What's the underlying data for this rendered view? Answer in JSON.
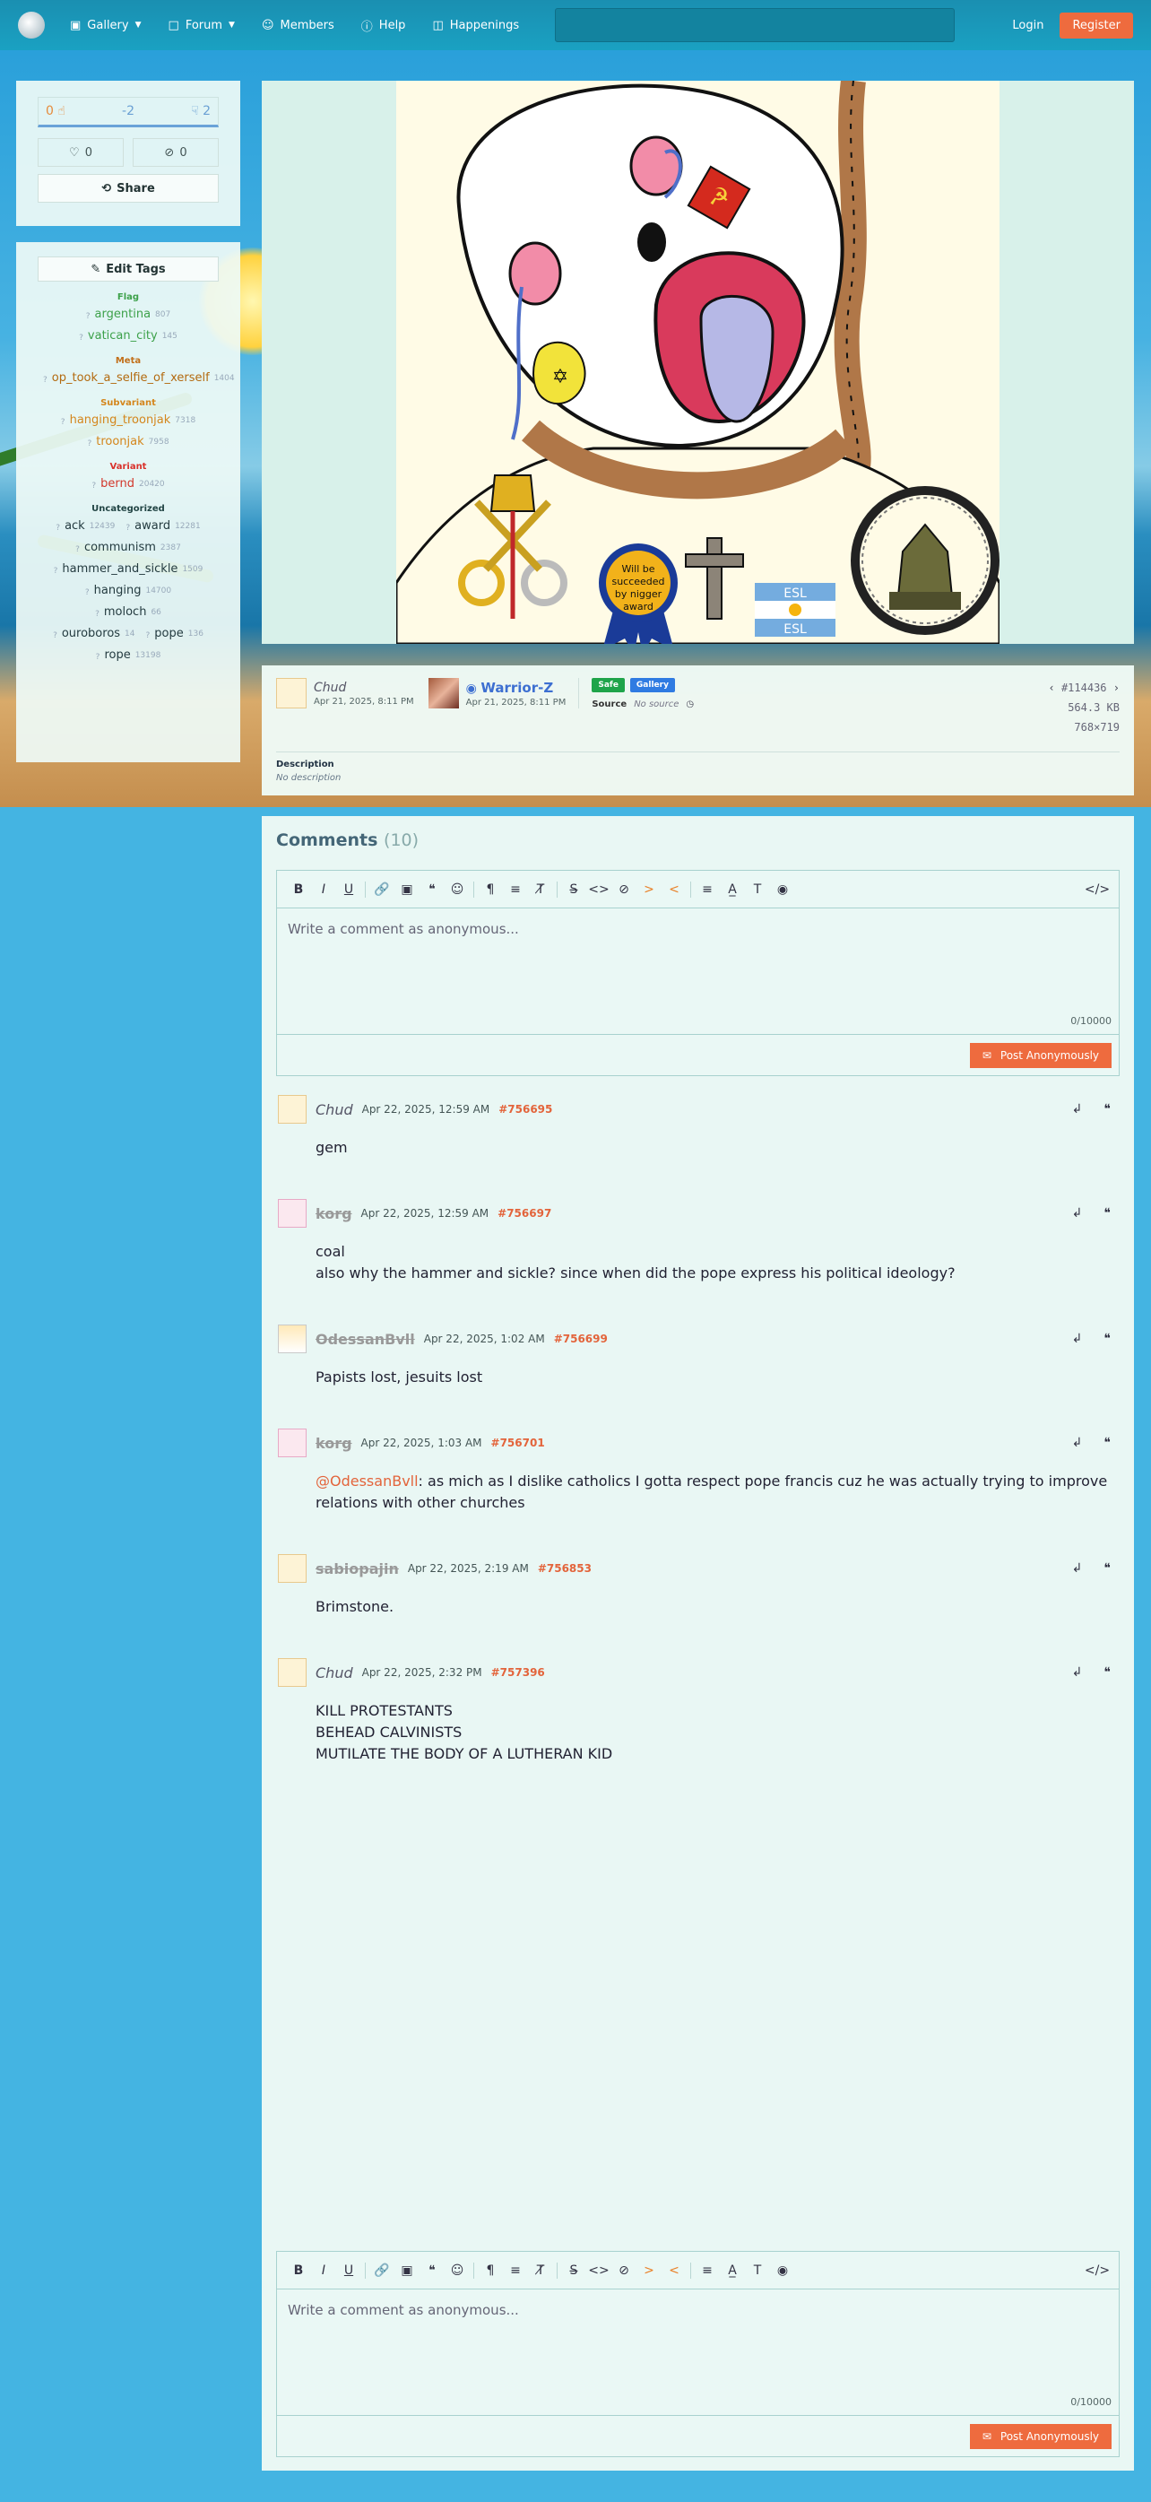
{
  "nav": {
    "items": [
      {
        "label": "Gallery",
        "icon": "image-icon",
        "dropdown": true
      },
      {
        "label": "Forum",
        "icon": "chat-icon",
        "dropdown": true
      },
      {
        "label": "Members",
        "icon": "user-icon",
        "dropdown": false
      },
      {
        "label": "Help",
        "icon": "help-icon",
        "dropdown": false
      },
      {
        "label": "Happenings",
        "icon": "book-icon",
        "dropdown": false
      }
    ],
    "search_placeholder": "",
    "login": "Login",
    "register": "Register"
  },
  "votes": {
    "up": "0",
    "score": "-2",
    "down": "2",
    "favorites": "0",
    "hidden": "0",
    "share": "Share"
  },
  "tags": {
    "edit_label": "Edit Tags",
    "groups": [
      {
        "title": "Flag",
        "tags": [
          [
            "argentina",
            "807"
          ],
          [
            "vatican_city",
            "145"
          ]
        ]
      },
      {
        "title": "Meta",
        "tags": [
          [
            "op_took_a_selfie_of_xerself",
            "1404"
          ]
        ]
      },
      {
        "title": "Subvariant",
        "tags": [
          [
            "hanging_troonjak",
            "7318"
          ],
          [
            "troonjak",
            "7958"
          ]
        ]
      },
      {
        "title": "Variant",
        "tags": [
          [
            "bernd",
            "20420"
          ]
        ]
      },
      {
        "title": "Uncategorized",
        "tags": [
          [
            "ack",
            "12439"
          ],
          [
            "award",
            "12281"
          ],
          [
            "communism",
            "2387"
          ],
          [
            "hammer_and_sickle",
            "1509"
          ],
          [
            "hanging",
            "14700"
          ],
          [
            "moloch",
            "66"
          ],
          [
            "ouroboros",
            "14"
          ],
          [
            "pope",
            "136"
          ],
          [
            "rope",
            "13198"
          ]
        ]
      }
    ]
  },
  "image": {
    "ribbon_text": "Will be succeeded by nigger award",
    "esl_text": "ESL"
  },
  "meta": {
    "uploader": {
      "name": "Chud",
      "date": "Apr 21, 2025, 8:11 PM"
    },
    "approver": {
      "name": "Warrior-Z",
      "date": "Apr 21, 2025, 8:11 PM"
    },
    "badges": [
      "Safe",
      "Gallery"
    ],
    "source_label": "Source",
    "source_value": "No source",
    "post_id": "#114436",
    "file_size": "564.3 KB",
    "dimensions": "768×719",
    "description_label": "Description",
    "description_value": "No description"
  },
  "comments": {
    "title": "Comments",
    "count": "(10)",
    "placeholder": "Write a comment as anonymous...",
    "char_count": "0/10000",
    "post_label": "Post Anonymously",
    "list": [
      {
        "user": "Chud",
        "strike": false,
        "date": "Apr 22, 2025, 12:59 AM",
        "id": "#756695",
        "body": [
          "gem"
        ]
      },
      {
        "user": "korg",
        "strike": true,
        "date": "Apr 22, 2025, 12:59 AM",
        "id": "#756697",
        "body": [
          "coal",
          "also why the hammer and sickle? since when did the pope express his political ideology?"
        ]
      },
      {
        "user": "OdessanBvll",
        "strike": true,
        "date": "Apr 22, 2025, 1:02 AM",
        "id": "#756699",
        "body": [
          "Papists lost, jesuits lost"
        ]
      },
      {
        "user": "korg",
        "strike": true,
        "date": "Apr 22, 2025, 1:03 AM",
        "id": "#756701",
        "mention": "@OdessanBvll",
        "body": [
          ": as mich as I dislike catholics I gotta respect pope francis cuz he was actually trying to improve relations with other churches"
        ]
      },
      {
        "user": "sabiopajin",
        "strike": true,
        "date": "Apr 22, 2025, 2:19 AM",
        "id": "#756853",
        "body": [
          "Brimstone."
        ]
      },
      {
        "user": "Chud",
        "strike": false,
        "date": "Apr 22, 2025, 2:32 PM",
        "id": "#757396",
        "body": [
          "KILL PROTESTANTS",
          "BEHEAD CALVINISTS",
          "MUTILATE THE BODY OF A LUTHERAN KID"
        ]
      }
    ]
  },
  "colors": {
    "accent": "#ee6b3e",
    "navbar": "#1a9ab9",
    "panel": "#e9f7f4",
    "link_blue": "#3d6fd1"
  }
}
